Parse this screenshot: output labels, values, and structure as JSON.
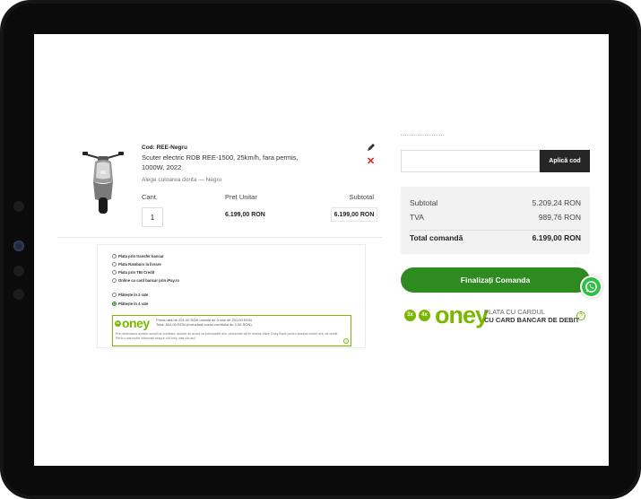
{
  "colors": {
    "accent_green": "#2e8b1f",
    "oney_green": "#7ab800",
    "remove_red": "#e0201b",
    "dark_button": "#262626"
  },
  "cart": {
    "item": {
      "code": "Cod: REE-Negru",
      "name": "Scuter electric RDB REE-1500, 25km/h, fara permis, 1000W, 2022",
      "note": "Alege culoarea dorita — Negru",
      "qty": "1",
      "unit_price": "6.199,00 RON",
      "subtotal": "6.199,00 RON"
    },
    "headers": {
      "qty": "Cant.",
      "unit_price": "Preț Unitar",
      "subtotal": "Subtotal"
    },
    "icons": {
      "edit": "pencil-icon",
      "remove": "close-icon"
    }
  },
  "payment": {
    "options": [
      "Plata prin transfer bancar",
      "Plata Ramburs la livrare",
      "Plata prin TBI Credit",
      "Online cu card bancar prin iPay.ro"
    ],
    "installments": [
      "Plătește în 3 rate",
      "Plătește în 4 rate"
    ],
    "selected_installment": 1,
    "oney": {
      "word": "oney",
      "badge3": "3x",
      "badge4": "4x",
      "line1": "Prima rată de 201,00 RON urmată de 3 rate de 201,00 RON",
      "line2": "Total: 804,00 RON (incluzând costul creditului de 0,00 RON)",
      "fine": "Prin selectarea acestei soluții de creditare, sunteți de acord ca informațiile dvs. personale să fie trimise către Oney Bank pentru analiza cererii dvs. de credit. Pentru mai multe informații despre 4XOney, dați clic aici.",
      "help": "?"
    }
  },
  "coupon": {
    "placeholder": "",
    "button": "Aplică cod"
  },
  "summary": {
    "subtotal_label": "Subtotal",
    "subtotal_value": "5.209,24 RON",
    "tva_label": "TVA",
    "tva_value": "989,76 RON",
    "total_label": "Total comandă",
    "total_value": "6.199,00 RON"
  },
  "checkout": {
    "button": "Finalizați Comanda"
  },
  "oney_banner": {
    "badge3": "3x",
    "badge4": "4x",
    "word": "oney",
    "line1": "PLATA CU CARDUL",
    "line2": "CU CARD BANCAR DE DEBIT",
    "help": "?"
  }
}
